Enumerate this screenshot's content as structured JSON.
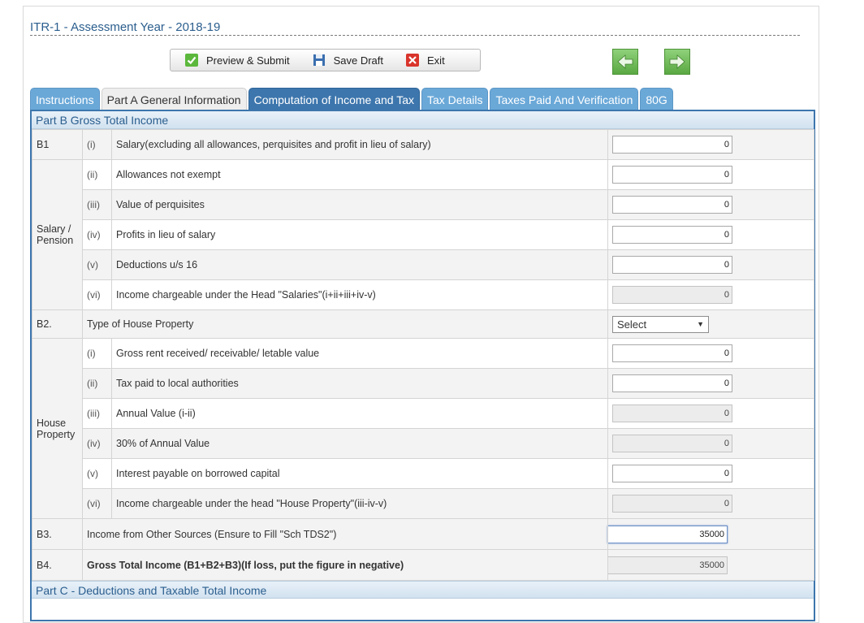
{
  "form": {
    "title": "ITR-1 - Assessment Year - 2018-19"
  },
  "actions": {
    "preview": "Preview & Submit",
    "save": "Save Draft",
    "exit": "Exit"
  },
  "tabs": [
    "Instructions",
    "Part A General Information",
    "Computation of Income and Tax",
    "Tax Details",
    "Taxes Paid And Verification",
    "80G"
  ],
  "partB": {
    "heading": "Part B Gross Total Income",
    "b1": {
      "code": "B1",
      "group": "Salary / Pension",
      "rows": [
        {
          "num": "(i)",
          "label": "Salary(excluding all allowances, perquisites and profit in lieu of salary)",
          "value": "0"
        },
        {
          "num": "(ii)",
          "label": "Allowances not exempt",
          "value": "0"
        },
        {
          "num": "(iii)",
          "label": "Value of perquisites",
          "value": "0"
        },
        {
          "num": "(iv)",
          "label": "Profits in lieu of salary",
          "value": "0"
        },
        {
          "num": "(v)",
          "label": "Deductions u/s 16",
          "value": "0"
        },
        {
          "num": "(vi)",
          "label": "Income chargeable under the Head \"Salaries\"(i+ii+iii+iv-v)",
          "value": "0"
        }
      ]
    },
    "b2": {
      "code": "B2.",
      "type_label": "Type of House Property",
      "type_value": "Select",
      "group": "House Property",
      "rows": [
        {
          "num": "(i)",
          "label": "Gross rent received/ receivable/ letable value",
          "value": "0"
        },
        {
          "num": "(ii)",
          "label": "Tax paid to local authorities",
          "value": "0"
        },
        {
          "num": "(iii)",
          "label": "Annual Value (i-ii)",
          "value": "0"
        },
        {
          "num": "(iv)",
          "label": "30% of Annual Value",
          "value": "0"
        },
        {
          "num": "(v)",
          "label": "Interest payable on borrowed capital",
          "value": "0"
        },
        {
          "num": "(vi)",
          "label": "Income chargeable under the head \"House Property\"(iii-iv-v)",
          "value": "0"
        }
      ]
    },
    "b3": {
      "code": "B3.",
      "label": "Income from Other Sources (Ensure to Fill \"Sch TDS2\")",
      "value": "35000"
    },
    "b4": {
      "code": "B4.",
      "label": "Gross Total Income (B1+B2+B3)(If loss, put the figure in negative)",
      "value": "35000"
    }
  },
  "partC": {
    "heading": "Part C - Deductions and Taxable Total Income"
  },
  "icons": [
    "check-icon",
    "save-icon",
    "close-icon",
    "arrow-left-icon",
    "arrow-right-icon",
    "dropdown-arrow-icon"
  ],
  "colors": {
    "tab_active": "#3d76ad",
    "tab": "#6aa8d8",
    "nav_green": "#5aa843"
  }
}
